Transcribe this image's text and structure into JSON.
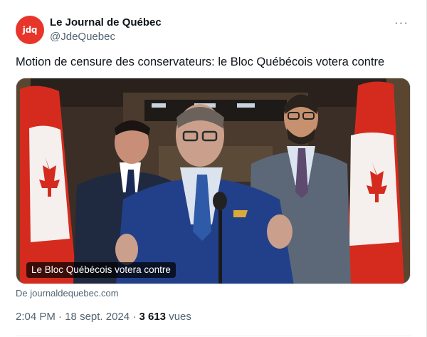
{
  "account": {
    "avatar_text": "jdq",
    "name": "Le Journal de Québec",
    "handle": "@JdeQuebec",
    "more_icon": "···"
  },
  "tweet": {
    "text": "Motion de censure des conservateurs: le Bloc Québécois votera contre"
  },
  "media": {
    "caption": "Le Bloc Québécois votera contre",
    "source": "De journaldequebec.com"
  },
  "meta": {
    "time": "2:04 PM",
    "separator": " · ",
    "date": "18 sept. 2024",
    "views_count": "3 613",
    "views_label": "vues"
  },
  "colors": {
    "brand": "#e8352b",
    "flag_red": "#d52b1e",
    "text_secondary": "#536471"
  },
  "icons": {
    "more": "more-icon"
  }
}
